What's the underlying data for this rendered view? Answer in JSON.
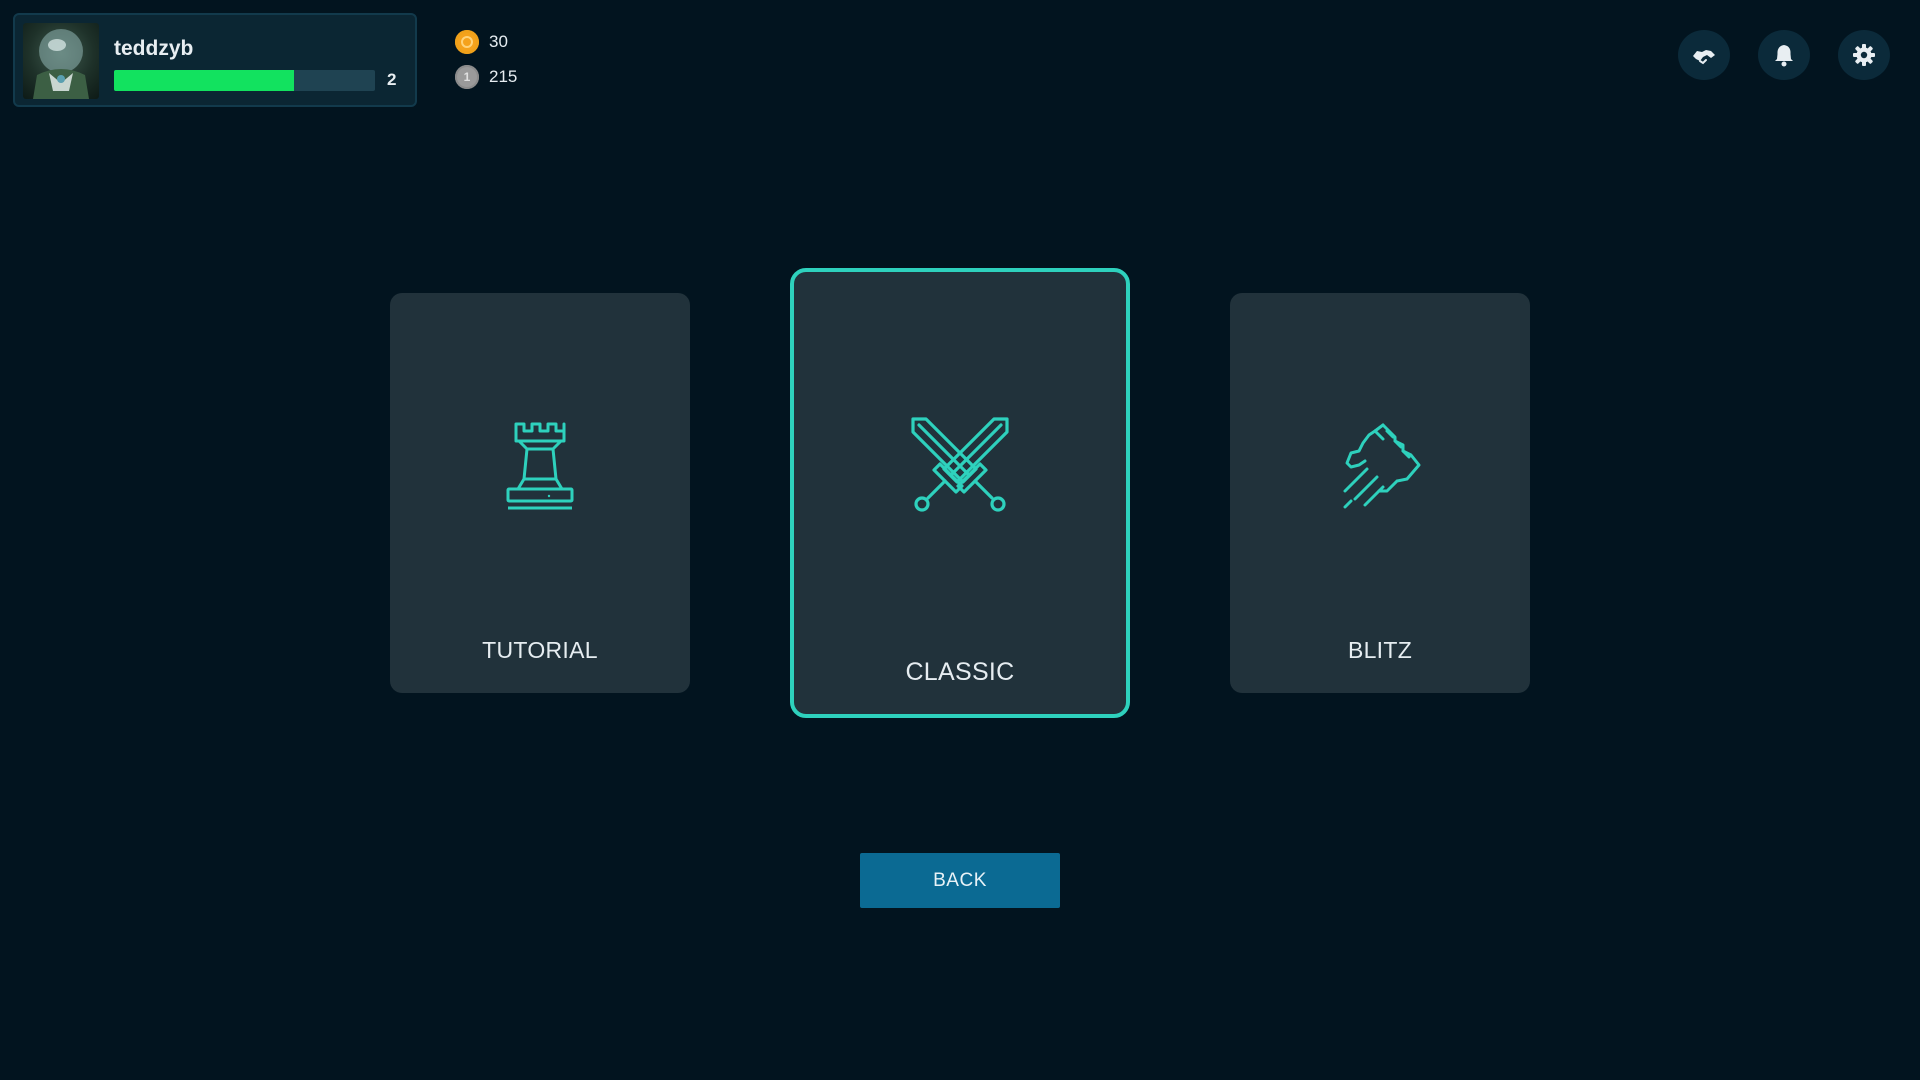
{
  "profile": {
    "username": "teddzyb",
    "level": "2",
    "xp_progress": 0.69,
    "avatar_icon": "character-portrait-icon"
  },
  "currencies": [
    {
      "name": "gold",
      "icon": "gold-coin-icon",
      "amount": "30",
      "color": "#f5a21c"
    },
    {
      "name": "silver",
      "icon": "silver-coin-icon",
      "amount": "215",
      "color": "#9a9a9a"
    }
  ],
  "top_actions": [
    {
      "icon": "handshake-icon"
    },
    {
      "icon": "bell-icon"
    },
    {
      "icon": "gear-icon"
    }
  ],
  "modes": [
    {
      "id": "tutorial",
      "label": "TUTORIAL",
      "icon": "rook-icon",
      "selected": false
    },
    {
      "id": "classic",
      "label": "CLASSIC",
      "icon": "crossed-swords-icon",
      "selected": true
    },
    {
      "id": "blitz",
      "label": "BLITZ",
      "icon": "fast-fist-icon",
      "selected": false
    }
  ],
  "back_label": "BACK",
  "colors": {
    "background": "#02141f",
    "card": "#21323b",
    "accent": "#2ed1bd",
    "xp_bar": "#12e25f",
    "back_button": "#0b6a93"
  }
}
